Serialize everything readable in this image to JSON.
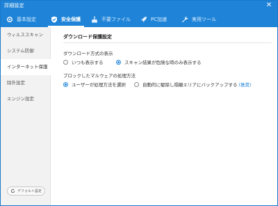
{
  "window": {
    "title": "詳細設定",
    "close_glyph": "✕"
  },
  "tabs": [
    {
      "label": "基本設定",
      "icon": "gear-icon"
    },
    {
      "label": "安全保護",
      "icon": "shield-icon"
    },
    {
      "label": "不要ファイル",
      "icon": "broom-icon"
    },
    {
      "label": "PC加速",
      "icon": "rocket-icon"
    },
    {
      "label": "実用ツール",
      "icon": "wrench-icon"
    }
  ],
  "active_tab": "安全保護",
  "sidebar": {
    "items": [
      {
        "label": "ウィルススキャン"
      },
      {
        "label": "システム防御"
      },
      {
        "label": "インターネット保護"
      },
      {
        "label": "除外設定"
      },
      {
        "label": "エンジン設定"
      }
    ],
    "active": "インターネット保護",
    "default_button": "デフォルト設定"
  },
  "main": {
    "section_title": "ダウンロード保護設定",
    "display_group": {
      "label": "ダウンロード方式の表示",
      "options": [
        "いつも表示する",
        "スキャン結果が危険な時のみ表示する"
      ],
      "selected": "スキャン結果が危険な時のみ表示する"
    },
    "malware_group": {
      "label": "ブロックしたマルウェアの処理方法",
      "options": [
        "ユーザーが処理方法を選択",
        "自動的に駆除し隔離エリアにバックアップする"
      ],
      "selected": "ユーザーが処理方法を選択",
      "recommend_link": "(推奨)"
    }
  },
  "colors": {
    "accent": "#1f84d8"
  }
}
